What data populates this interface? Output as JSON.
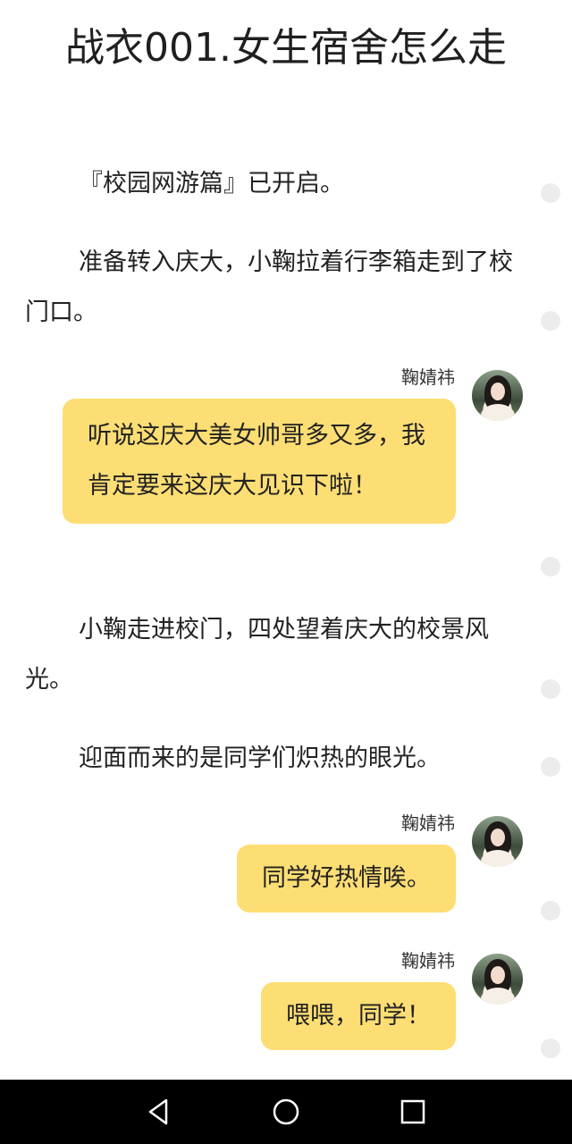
{
  "chapter": {
    "title": "战衣001.女生宿舍怎么走"
  },
  "story": {
    "p1": "『校园网游篇』已开启。",
    "p2": "准备转入庆大，小鞠拉着行李箱走到了校门口。",
    "p3": "小鞠走进校门，四处望着庆大的校景风光。",
    "p4": "迎面而来的是同学们炽热的眼光。"
  },
  "messages": [
    {
      "sender": "鞠婧祎",
      "text": "听说这庆大美女帅哥多又多，我肯定要来这庆大见识下啦！"
    },
    {
      "sender": "鞠婧祎",
      "text": "同学好热情唉。"
    },
    {
      "sender": "鞠婧祎",
      "text": "喂喂，同学！"
    }
  ],
  "colors": {
    "bubble": "#fdde74",
    "comment_dot": "#ececec",
    "nav_bar": "#000000"
  },
  "icons": {
    "comment": "comment-dot-icon",
    "back": "triangle-back-icon",
    "home": "circle-home-icon",
    "recent": "square-recent-icon"
  }
}
